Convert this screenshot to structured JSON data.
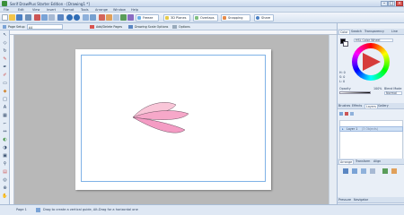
{
  "title_bar": {
    "title": "Serif DrawPlus Starter Edition - [Drawing1 *]",
    "minimize": "–",
    "maximize": "□",
    "close": "×"
  },
  "menu": [
    "File",
    "Edit",
    "View",
    "Insert",
    "Format",
    "Tools",
    "Arrange",
    "Window",
    "Help"
  ],
  "toolbar": {
    "buttons": [
      "Freeze",
      "3D Planes",
      "Overlaps",
      "Snapping",
      "Share"
    ]
  },
  "toolbar2": {
    "page_setup": "Page Setup",
    "page_size": "A4",
    "add_delete_pages": "Add/Delete Pages",
    "drawing_scale": "Drawing Scale Options",
    "options": "Options"
  },
  "right_panel": {
    "color_tabs": [
      "Color",
      "Swatch",
      "Transparency",
      "Line"
    ],
    "color_mode": "HSL Color Wheel",
    "hsl": {
      "h": "H: 0",
      "s": "S: 0",
      "l": "L: 0"
    },
    "opacity_label": "Opacity",
    "opacity_value": "100%",
    "blend_mode_label": "Blend Mode",
    "blend_mode": "Normal",
    "layer_tabs": [
      "Brushes",
      "Effects",
      "Layers",
      "Gallery"
    ],
    "layer_name": "Layer 1",
    "layer_objects": "(3 Objects)",
    "arrange_tabs": [
      "Arrange",
      "Transform",
      "Align"
    ],
    "bottom_tabs": [
      "Pressure",
      "Navigator"
    ]
  },
  "status_bar": {
    "page": "Page 1",
    "hint": "Drag to create a vertical guide, Alt-Drag for a horizontal one"
  },
  "icons": [
    "pointer-icon",
    "node-icon",
    "pencil-icon",
    "pen-icon",
    "brush-icon",
    "shape-icon",
    "text-icon",
    "fill-icon",
    "zoom-icon"
  ],
  "colors": {
    "accent": "#3a8f3a",
    "petal_fill_1": "#f9c6d8",
    "petal_fill_2": "#f6a8c9",
    "petal_fill_3": "#f49cc4"
  }
}
